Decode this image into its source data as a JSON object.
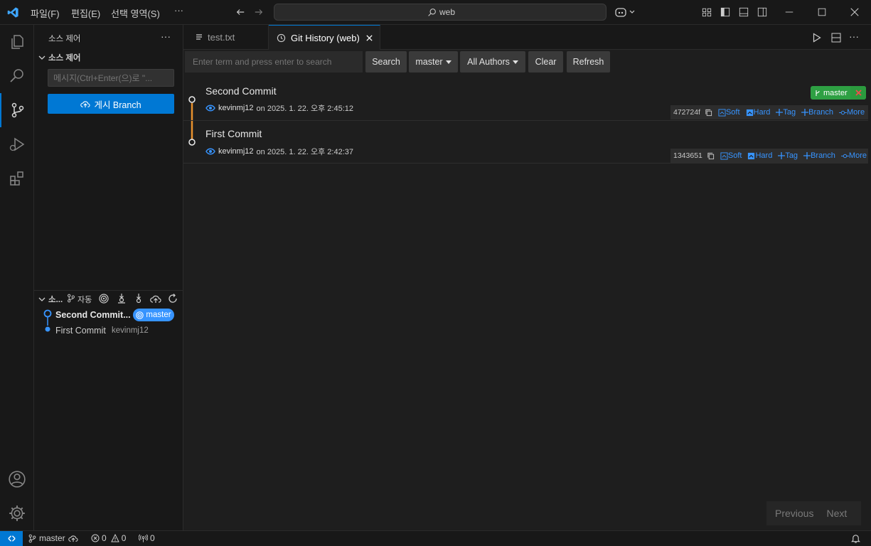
{
  "titlebar": {
    "menus": [
      "파일(F)",
      "편집(E)",
      "선택 영역(S)"
    ],
    "more": "···",
    "search_text": "web"
  },
  "sidebar": {
    "header": "소스 제어",
    "section": "소스 제어",
    "message_placeholder": "메시지(Ctrl+Enter(으)로 \"...",
    "publish_button": "게시 Branch",
    "graph_header": "소...",
    "graph_auto": "자동",
    "graph_items": [
      {
        "label": "Second Commit...",
        "badge": "master"
      },
      {
        "label": "First Commit",
        "author": "kevinmj12"
      }
    ]
  },
  "tabs": [
    {
      "label": "test.txt"
    },
    {
      "label": "Git History (web)"
    }
  ],
  "toolbar": {
    "search_placeholder": "Enter term and press enter to search",
    "search_button": "Search",
    "branch_button": "master",
    "authors_button": "All Authors",
    "clear_button": "Clear",
    "refresh_button": "Refresh"
  },
  "commits": [
    {
      "title": "Second Commit",
      "author": "kevinmj12",
      "date_text": "on 2025. 1. 22. 오후 2:45:12",
      "hash": "472724f",
      "branch_tag": "master"
    },
    {
      "title": "First Commit",
      "author": "kevinmj12",
      "date_text": "on 2025. 1. 22. 오후 2:42:37",
      "hash": "1343651"
    }
  ],
  "commit_actions": {
    "soft": "Soft",
    "hard": "Hard",
    "tag": "Tag",
    "branch": "Branch",
    "more": "More"
  },
  "pagination": {
    "previous": "Previous",
    "next": "Next"
  },
  "statusbar": {
    "branch": "master",
    "errors": "0",
    "warnings": "0",
    "ports": "0"
  },
  "colors": {
    "accent": "#0078d4",
    "status_remote": "#0078d4",
    "graph_line": "#e8912d",
    "tag_green": "#2ea043",
    "link": "#3794ff"
  }
}
